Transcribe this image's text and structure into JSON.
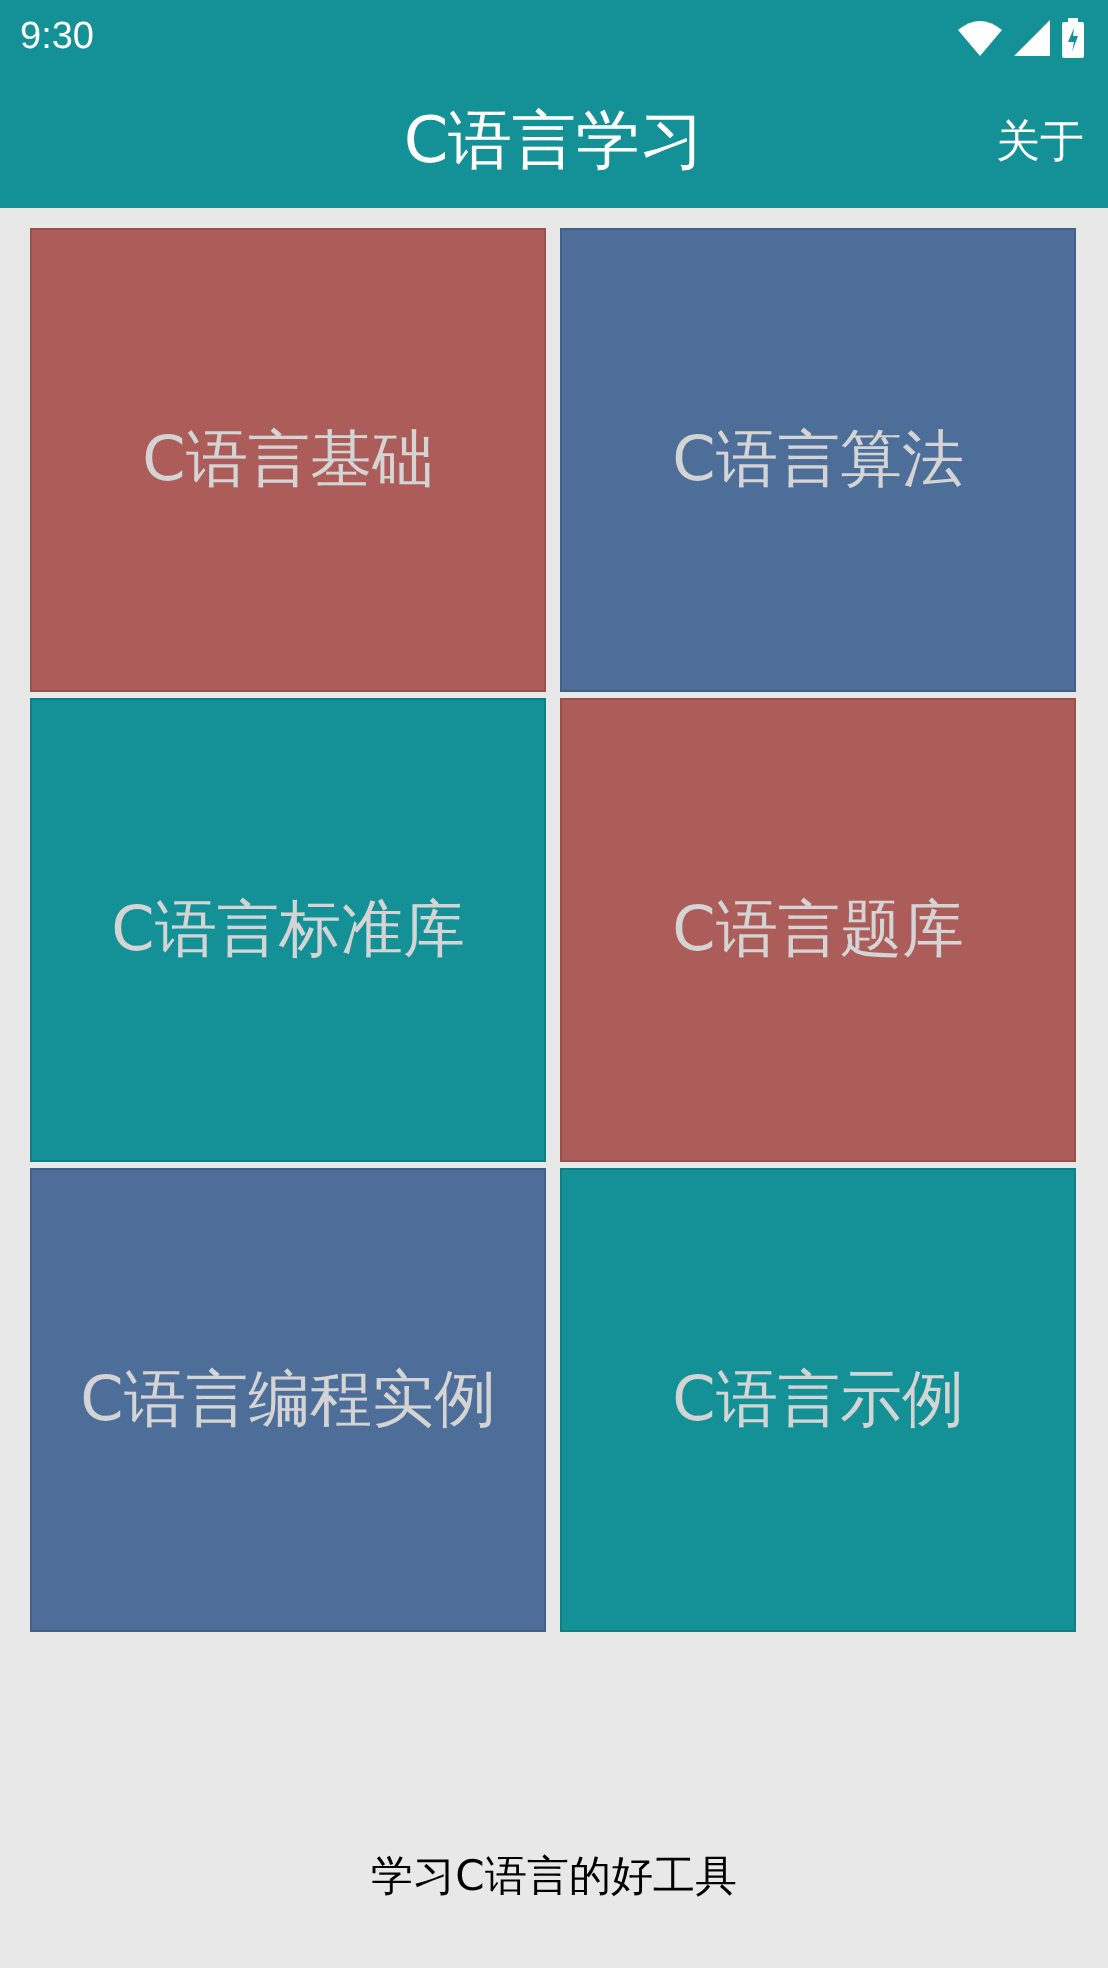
{
  "status_bar": {
    "time": "9:30"
  },
  "app_bar": {
    "title": "C语言学习",
    "action": "关于"
  },
  "tiles": [
    {
      "label": "C语言基础",
      "color": "#ad5d59"
    },
    {
      "label": "C语言算法",
      "color": "#4d6e99"
    },
    {
      "label": "C语言标准库",
      "color": "#139196"
    },
    {
      "label": "C语言题库",
      "color": "#ad5d59"
    },
    {
      "label": "C语言编程实例",
      "color": "#4d6e99"
    },
    {
      "label": "C语言示例",
      "color": "#139196"
    }
  ],
  "footer": "学习C语言的好工具"
}
